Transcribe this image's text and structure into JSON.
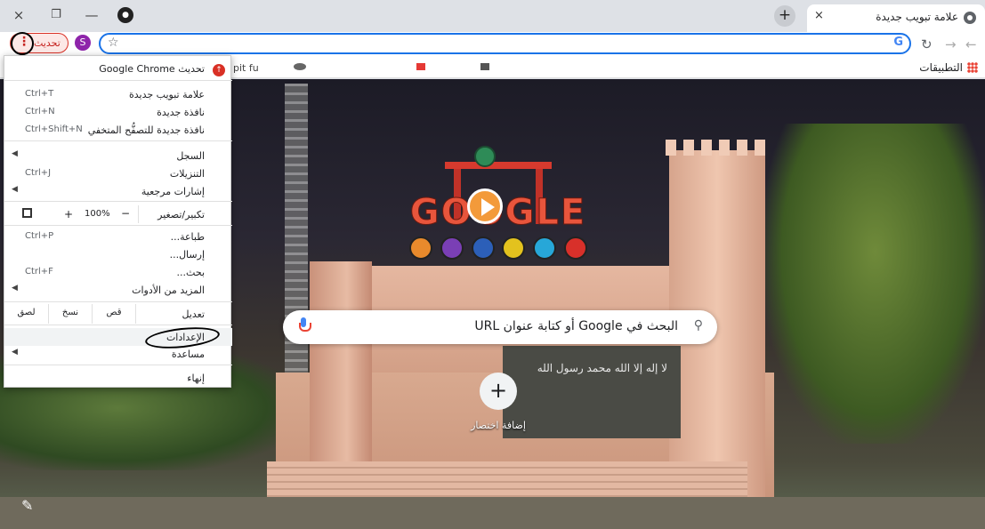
{
  "tabstrip": {
    "tab_title": "علامة تبويب جديدة",
    "new_tab_label": "+",
    "tab_close": "×",
    "window_close": "×",
    "window_restore": "❐",
    "window_minimize": "—"
  },
  "toolbar": {
    "update_label": "تحديث",
    "profile_initial": "S",
    "omnibox_value": "",
    "google_icon": "G",
    "reload_icon": "↻",
    "back_icon": "←",
    "forward_icon": "→"
  },
  "bookmarks": {
    "apps_label": "التطبيقات",
    "partial_text": "pit fu"
  },
  "ntp": {
    "search_placeholder": "البحث في Google أو كتابة عنوان URL",
    "shortcut_add": "إضافة اختصار",
    "shortcut_plus": "+",
    "doodle_word": "GOOGLE",
    "flag_text": "لا إله إلا الله محمد رسول الله"
  },
  "menu": {
    "update_item": "تحديث Google Chrome",
    "new_tab": "علامة تبويب جديدة",
    "new_tab_key": "Ctrl+T",
    "new_window": "نافذة جديدة",
    "new_window_key": "Ctrl+N",
    "incognito": "نافذة جديدة للتصفُّح المتخفي",
    "incognito_key": "Ctrl+Shift+N",
    "history": "السجل",
    "downloads": "التنزيلات",
    "downloads_key": "Ctrl+J",
    "bookmarks": "إشارات مرجعية",
    "zoom_label": "تكبير/تصغير",
    "zoom_value": "100%",
    "zoom_plus": "+",
    "zoom_minus": "−",
    "print": "طباعة...",
    "print_key": "Ctrl+P",
    "cast": "إرسال...",
    "find": "بحث...",
    "find_key": "Ctrl+F",
    "more_tools": "المزيد من الأدوات",
    "edit": "تعديل",
    "cut": "قص",
    "copy": "نسخ",
    "paste": "لصق",
    "settings": "الإعدادات",
    "help": "مساعدة",
    "exit": "إنهاء"
  },
  "colors": {
    "omnibox_border": "#1a73e8",
    "update_red": "#d93025",
    "profile": "#8e24aa"
  }
}
